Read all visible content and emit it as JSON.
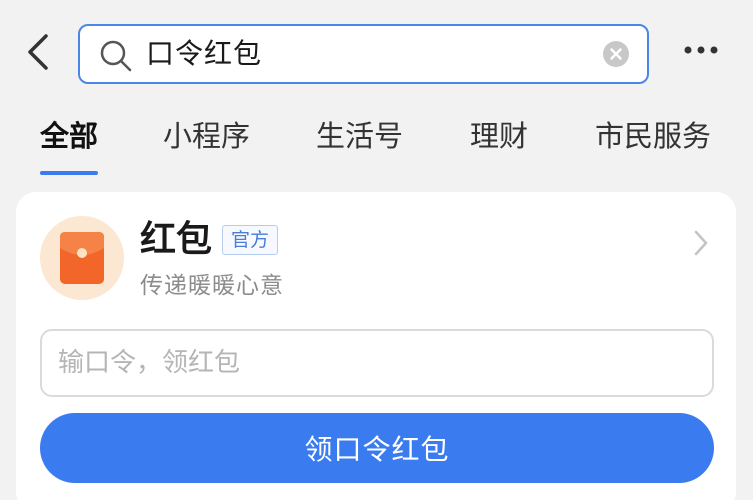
{
  "search": {
    "query": "口令红包"
  },
  "tabs": [
    {
      "label": "全部",
      "active": true
    },
    {
      "label": "小程序",
      "active": false
    },
    {
      "label": "生活号",
      "active": false
    },
    {
      "label": "理财",
      "active": false
    },
    {
      "label": "市民服务",
      "active": false
    }
  ],
  "result": {
    "title": "红包",
    "badge": "官方",
    "subtitle": "传递暖暖心意",
    "icon": "red-envelope-icon",
    "input_placeholder": "输口令，领红包",
    "button_label": "领口令红包"
  },
  "colors": {
    "accent": "#3b7bf0",
    "envelope": "#f2662a",
    "avatar_bg": "#fbe7d2"
  }
}
